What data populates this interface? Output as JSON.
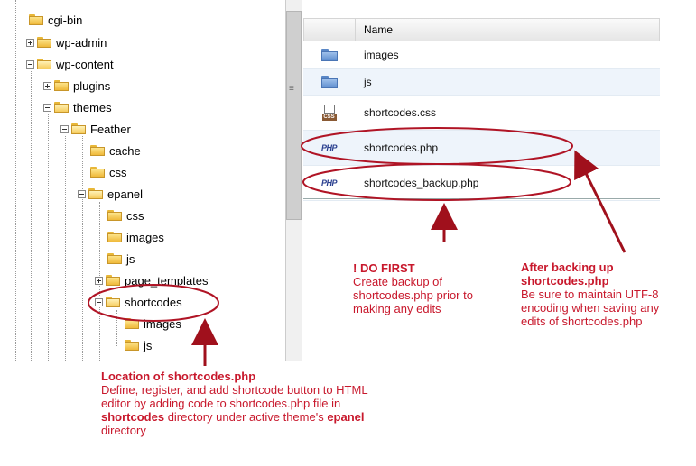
{
  "tree": {
    "nodes": [
      {
        "label": "cgi-bin",
        "toggle": "none",
        "open": false
      },
      {
        "label": "wp-admin",
        "toggle": "plus",
        "open": false
      },
      {
        "label": "wp-content",
        "toggle": "minus",
        "open": true
      },
      {
        "label": "plugins",
        "toggle": "plus",
        "open": false
      },
      {
        "label": "themes",
        "toggle": "minus",
        "open": true
      },
      {
        "label": "Feather",
        "toggle": "minus",
        "open": true
      },
      {
        "label": "cache",
        "toggle": "none",
        "open": false
      },
      {
        "label": "css",
        "toggle": "none",
        "open": false
      },
      {
        "label": "epanel",
        "toggle": "minus",
        "open": true
      },
      {
        "label": "css",
        "toggle": "none",
        "open": false
      },
      {
        "label": "images",
        "toggle": "none",
        "open": false
      },
      {
        "label": "js",
        "toggle": "none",
        "open": false
      },
      {
        "label": "page_templates",
        "toggle": "plus",
        "open": false
      },
      {
        "label": "shortcodes",
        "toggle": "minus",
        "open": true
      },
      {
        "label": "images",
        "toggle": "none",
        "open": false
      },
      {
        "label": "js",
        "toggle": "none",
        "open": false
      }
    ]
  },
  "filelist": {
    "header": {
      "name": "Name"
    },
    "rows": [
      {
        "name": "images",
        "icon": "folder-icon"
      },
      {
        "name": "js",
        "icon": "folder-icon"
      },
      {
        "name": "shortcodes.css",
        "icon": "css-file-icon"
      },
      {
        "name": "shortcodes.php",
        "icon": "php-file-icon"
      },
      {
        "name": "shortcodes_backup.php",
        "icon": "php-file-icon"
      }
    ],
    "php_icon_text": "PHP",
    "css_icon_text": "CSS"
  },
  "annotations": {
    "do_first": {
      "title": "! DO FIRST",
      "body": [
        "Create backup of",
        "shortcodes.php prior to",
        "making any edits"
      ]
    },
    "after_backup": {
      "title": [
        "After backing up",
        "shortcodes.php"
      ],
      "body": [
        "Be sure to maintain UTF-8",
        "encoding when saving any",
        "edits of shortcodes.php"
      ]
    },
    "location": {
      "title": "Location of shortcodes.php",
      "line1": "Define, register, and add shortcode button to HTML",
      "line2": "editor by adding code to shortcodes.php file in",
      "line3_bold": "shortcodes",
      "line3_rest": " directory under active theme's ",
      "line3_bold2": "epanel",
      "line4": "directory"
    }
  },
  "colors": {
    "annotation": "#c8182c"
  }
}
